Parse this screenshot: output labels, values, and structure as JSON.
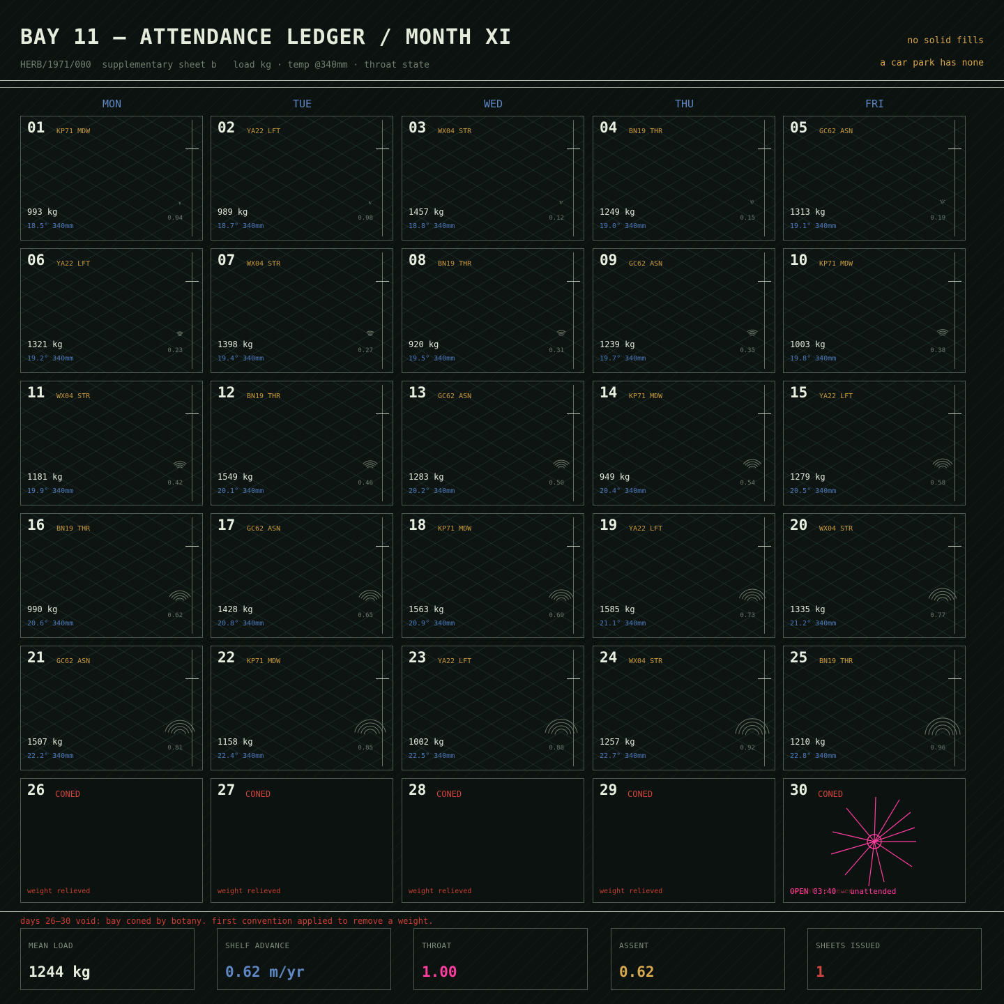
{
  "header": {
    "title": "BAY 11 — ATTENDANCE LEDGER / MONTH XI",
    "subtitle": "HERB/1971/000  supplementary sheet b   load kg · temp @340mm · throat state",
    "note1": "no solid fills",
    "note2": "a car park has none"
  },
  "weekdays": [
    "MON",
    "TUE",
    "WED",
    "THU",
    "FRI"
  ],
  "days": [
    {
      "day": "01",
      "code": "KP71 MDW",
      "load": "993 kg",
      "temp": "18.5° 340mm",
      "value": "0.04"
    },
    {
      "day": "02",
      "code": "YA22 LFT",
      "load": "989 kg",
      "temp": "18.7° 340mm",
      "value": "0.08"
    },
    {
      "day": "03",
      "code": "WX04 STR",
      "load": "1457 kg",
      "temp": "18.8° 340mm",
      "value": "0.12"
    },
    {
      "day": "04",
      "code": "BN19 THR",
      "load": "1249 kg",
      "temp": "19.0° 340mm",
      "value": "0.15"
    },
    {
      "day": "05",
      "code": "GC62 ASN",
      "load": "1313 kg",
      "temp": "19.1° 340mm",
      "value": "0.19"
    },
    {
      "day": "06",
      "code": "YA22 LFT",
      "load": "1321 kg",
      "temp": "19.2° 340mm",
      "value": "0.23"
    },
    {
      "day": "07",
      "code": "WX04 STR",
      "load": "1398 kg",
      "temp": "19.4° 340mm",
      "value": "0.27"
    },
    {
      "day": "08",
      "code": "BN19 THR",
      "load": "920 kg",
      "temp": "19.5° 340mm",
      "value": "0.31"
    },
    {
      "day": "09",
      "code": "GC62 ASN",
      "load": "1239 kg",
      "temp": "19.7° 340mm",
      "value": "0.35"
    },
    {
      "day": "10",
      "code": "KP71 MDW",
      "load": "1003 kg",
      "temp": "19.8° 340mm",
      "value": "0.38"
    },
    {
      "day": "11",
      "code": "WX04 STR",
      "load": "1181 kg",
      "temp": "19.9° 340mm",
      "value": "0.42"
    },
    {
      "day": "12",
      "code": "BN19 THR",
      "load": "1549 kg",
      "temp": "20.1° 340mm",
      "value": "0.46"
    },
    {
      "day": "13",
      "code": "GC62 ASN",
      "load": "1283 kg",
      "temp": "20.2° 340mm",
      "value": "0.50"
    },
    {
      "day": "14",
      "code": "KP71 MDW",
      "load": "949 kg",
      "temp": "20.4° 340mm",
      "value": "0.54"
    },
    {
      "day": "15",
      "code": "YA22 LFT",
      "load": "1279 kg",
      "temp": "20.5° 340mm",
      "value": "0.58"
    },
    {
      "day": "16",
      "code": "BN19 THR",
      "load": "990 kg",
      "temp": "20.6° 340mm",
      "value": "0.62"
    },
    {
      "day": "17",
      "code": "GC62 ASN",
      "load": "1428 kg",
      "temp": "20.8° 340mm",
      "value": "0.65"
    },
    {
      "day": "18",
      "code": "KP71 MDW",
      "load": "1563 kg",
      "temp": "20.9° 340mm",
      "value": "0.69"
    },
    {
      "day": "19",
      "code": "YA22 LFT",
      "load": "1585 kg",
      "temp": "21.1° 340mm",
      "value": "0.73"
    },
    {
      "day": "20",
      "code": "WX04 STR",
      "load": "1335 kg",
      "temp": "21.2° 340mm",
      "value": "0.77"
    },
    {
      "day": "21",
      "code": "GC62 ASN",
      "load": "1507 kg",
      "temp": "22.2° 340mm",
      "value": "0.81"
    },
    {
      "day": "22",
      "code": "KP71 MDW",
      "load": "1158 kg",
      "temp": "22.4° 340mm",
      "value": "0.85"
    },
    {
      "day": "23",
      "code": "YA22 LFT",
      "load": "1002 kg",
      "temp": "22.5° 340mm",
      "value": "0.88"
    },
    {
      "day": "24",
      "code": "WX04 STR",
      "load": "1257 kg",
      "temp": "22.7° 340mm",
      "value": "0.92"
    },
    {
      "day": "25",
      "code": "BN19 THR",
      "load": "1210 kg",
      "temp": "22.8° 340mm",
      "value": "0.96"
    }
  ],
  "void_days": [
    {
      "day": "26",
      "status": "CONED",
      "note": "weight relieved"
    },
    {
      "day": "27",
      "status": "CONED",
      "note": "weight relieved"
    },
    {
      "day": "28",
      "status": "CONED",
      "note": "weight relieved"
    },
    {
      "day": "29",
      "status": "CONED",
      "note": "weight relieved"
    },
    {
      "day": "30",
      "status": "CONED",
      "note": "weight relieved",
      "open_note": "OPEN 03:40 — unattended"
    }
  ],
  "void_note": "days 26–30 void: bay coned by botany. first convention applied to remove a weight.",
  "stats": [
    {
      "label": "MEAN LOAD",
      "value": "1244 kg",
      "color": "#e6ecdc"
    },
    {
      "label": "SHELF ADVANCE",
      "value": "0.62 m/yr",
      "color": "#5f87c4"
    },
    {
      "label": "THROAT",
      "value": "1.00",
      "color": "#ff3ea0"
    },
    {
      "label": "ASSENT",
      "value": "0.62",
      "color": "#d7a84f"
    },
    {
      "label": "SHEETS ISSUED",
      "value": "1",
      "color": "#d0463c"
    }
  ],
  "colors": {
    "background": "#0c120f",
    "code": "#c99a3f",
    "temp": "#5f87c4",
    "coned": "#d0463c",
    "open": "#ff3ea0"
  }
}
